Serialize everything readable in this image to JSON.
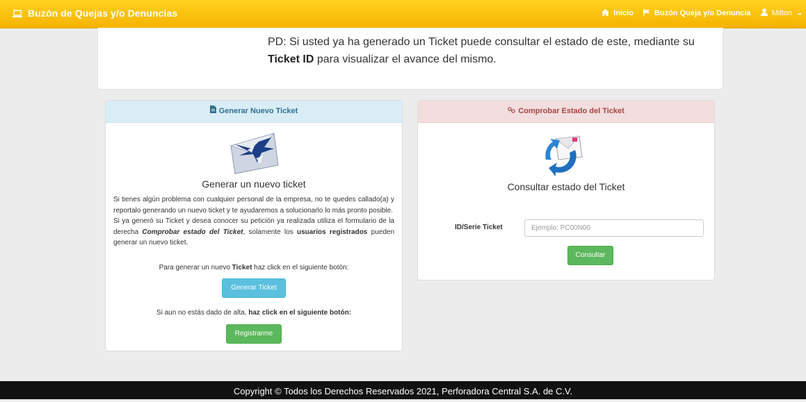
{
  "navbar": {
    "brand": "Buzón de Quejas y/o Denuncias",
    "links": [
      {
        "label": "Inicio",
        "icon": "home-icon"
      },
      {
        "label": "Buzón Queja y/o Denuncia",
        "icon": "flag-icon"
      },
      {
        "label": "Milton",
        "icon": "user-icon"
      }
    ]
  },
  "notice": {
    "text_1": "PD: Si usted ya ha generado un Ticket puede consultar el estado de este, mediante su",
    "text_bold": "Ticket ID",
    "text_2": " para visualizar el avance del mismo."
  },
  "new_ticket": {
    "header": "Generar Nuevo Ticket",
    "heading": "Generar un nuevo ticket",
    "desc_1": "Si tienes algún problema con cualquier personal de la empresa, no te quedes callado(a) y reportalo generando un nuevo ticket y te ayudaremos a solucionarlo lo más pronto posible.",
    "desc_2a": "Si ya generó su Ticket y desea conocer su petición ya realizada utiliza el formulario de la derecha ",
    "desc_2b": "Comprobar estado del Ticket",
    "desc_2c": ", solamente los ",
    "desc_2d": "usuarios registrados",
    "desc_2e": " pueden generar un nuevo ticket.",
    "line_1a": "Para generar un nuevo ",
    "line_1b": "Ticket",
    "line_1c": " haz click en el siguiente botón:",
    "button_generate": "Generar Ticket",
    "line_2a": "Si aun no estás dado de alta, ",
    "line_2b": "haz click en el siguiente botón:",
    "button_register": "Registrarme"
  },
  "check_ticket": {
    "header": "Comprobar Estado del Ticket",
    "heading": "Consultar estado del Ticket",
    "field_label": "ID/Serie Ticket",
    "field_placeholder": "Ejemplo: PC00N00",
    "button_consult": "Consultar"
  },
  "footer": {
    "text": "Copyright © Todos los Derechos Reservados 2021, Perforadora Central S.A. de C.V."
  },
  "colors": {
    "navbar": "#f7bf0a",
    "info_panel": "#d9edf7",
    "danger_panel": "#f2dede",
    "btn_info": "#5bc0de",
    "btn_success": "#5cb85c",
    "footer": "#111111"
  }
}
